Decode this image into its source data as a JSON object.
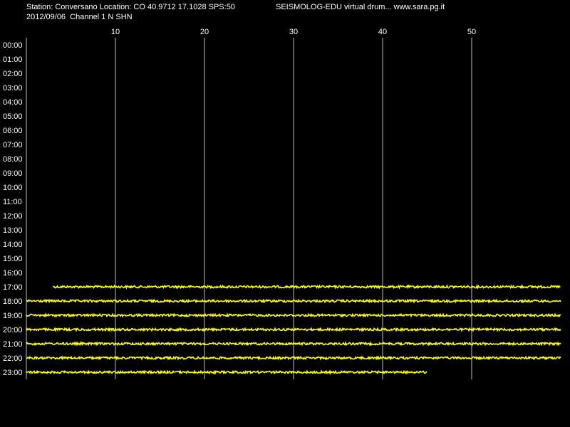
{
  "header": {
    "station_line": "Station: Conversano Location: CO 40.9712 17.1028 SPS:50",
    "date_line": "2012/09/06  Channel 1 N SHN",
    "brand": "SEISMOLOG-EDU virtual drum... www.sara.pg.it"
  },
  "chart_data": {
    "type": "line",
    "title": "",
    "xlabel": "",
    "ylabel": "",
    "xlim": [
      0,
      60
    ],
    "x_ticks": [
      10,
      20,
      30,
      40,
      50
    ],
    "grid": true,
    "y_categories": [
      "00:00",
      "01:00",
      "02:00",
      "03:00",
      "04:00",
      "05:00",
      "06:00",
      "07:00",
      "08:00",
      "09:00",
      "10:00",
      "11:00",
      "12:00",
      "13:00",
      "14:00",
      "15:00",
      "16:00",
      "17:00",
      "18:00",
      "19:00",
      "20:00",
      "21:00",
      "22:00",
      "23:00"
    ],
    "trace_color": "#ffff00",
    "grid_color": "#c0c0c0",
    "traces": [
      {
        "hour": "17:00",
        "start_min": 3,
        "end_min": 60
      },
      {
        "hour": "18:00",
        "start_min": 0,
        "end_min": 60
      },
      {
        "hour": "19:00",
        "start_min": 0,
        "end_min": 60
      },
      {
        "hour": "20:00",
        "start_min": 0,
        "end_min": 60
      },
      {
        "hour": "21:00",
        "start_min": 0,
        "end_min": 60
      },
      {
        "hour": "22:00",
        "start_min": 0,
        "end_min": 60
      },
      {
        "hour": "23:00",
        "start_min": 0,
        "end_min": 45
      }
    ]
  }
}
